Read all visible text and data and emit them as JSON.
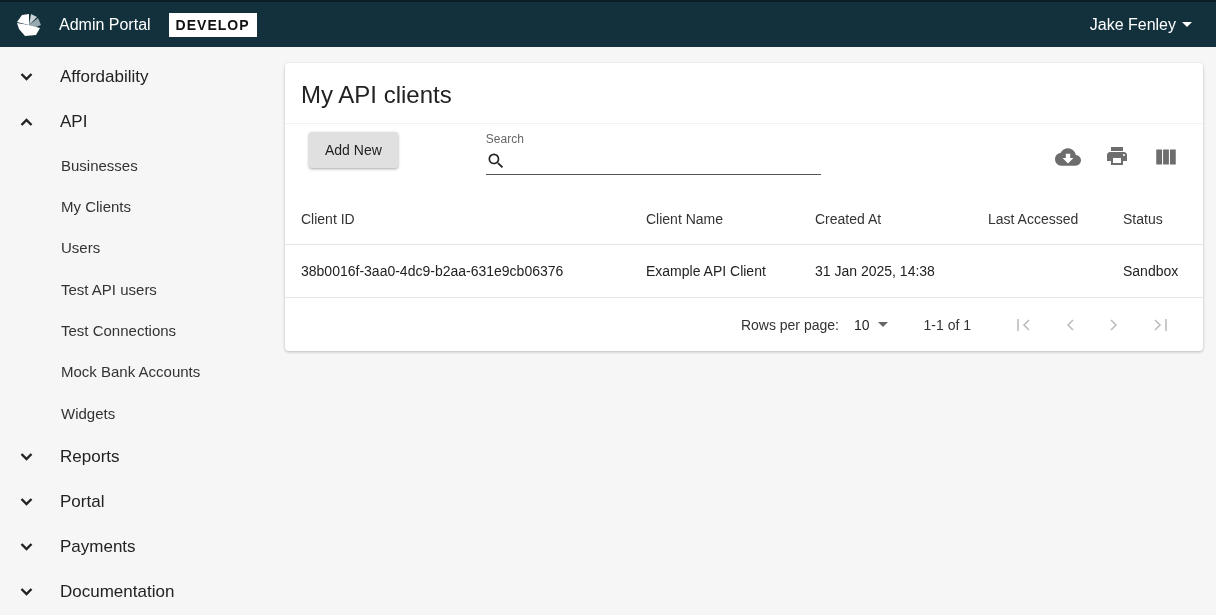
{
  "header": {
    "title": "Admin Portal",
    "environment": "DEVELOP",
    "user": "Jake Fenley"
  },
  "sidebar": {
    "items": [
      {
        "label": "Affordability",
        "expanded": false
      },
      {
        "label": "API",
        "expanded": true,
        "children": [
          {
            "label": "Businesses"
          },
          {
            "label": "My Clients"
          },
          {
            "label": "Users"
          },
          {
            "label": "Test API users"
          },
          {
            "label": "Test Connections"
          },
          {
            "label": "Mock Bank Accounts"
          },
          {
            "label": "Widgets"
          }
        ]
      },
      {
        "label": "Reports",
        "expanded": false
      },
      {
        "label": "Portal",
        "expanded": false
      },
      {
        "label": "Payments",
        "expanded": false
      },
      {
        "label": "Documentation",
        "expanded": false
      }
    ]
  },
  "card": {
    "title": "My API clients",
    "add_button": "Add New",
    "search": {
      "label": "Search"
    }
  },
  "table": {
    "columns": [
      "Client ID",
      "Client Name",
      "Created At",
      "Last Accessed",
      "Status"
    ],
    "rows": [
      [
        "38b0016f-3aa0-4dc9-b2aa-631e9cb06376",
        "Example API Client",
        "31 Jan 2025, 14:38",
        "",
        "Sandbox"
      ]
    ]
  },
  "pagination": {
    "rows_per_page_label": "Rows per page:",
    "rows_per_page": "10",
    "range": "1-1 of 1",
    "buttons": [
      {
        "kind": "first",
        "disabled": true
      },
      {
        "kind": "prev",
        "disabled": true
      },
      {
        "kind": "next",
        "disabled": true
      },
      {
        "kind": "last",
        "disabled": true
      }
    ]
  }
}
